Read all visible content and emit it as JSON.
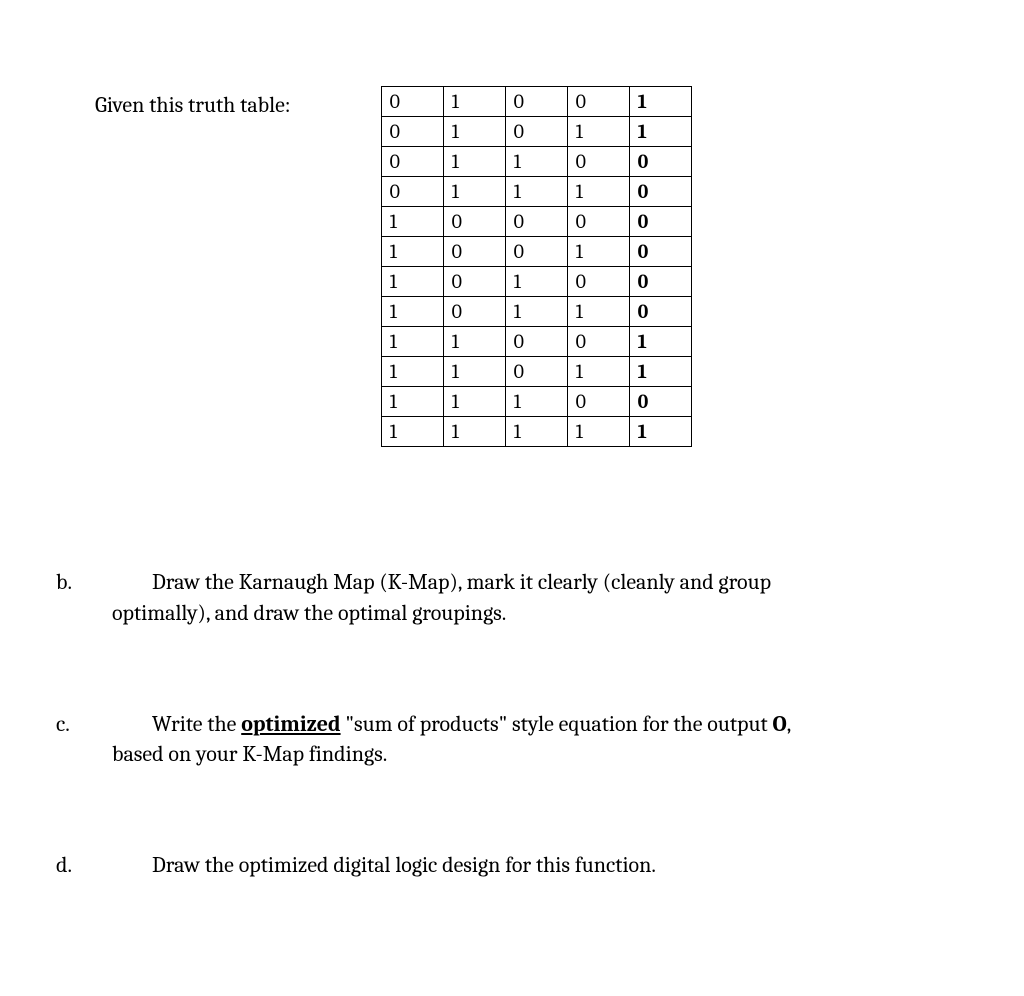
{
  "prompt": "Given this truth table:",
  "chart_data": {
    "type": "table",
    "columns": 5,
    "rows": [
      [
        0,
        1,
        0,
        0,
        1
      ],
      [
        0,
        1,
        0,
        1,
        1
      ],
      [
        0,
        1,
        1,
        0,
        0
      ],
      [
        0,
        1,
        1,
        1,
        0
      ],
      [
        1,
        0,
        0,
        0,
        0
      ],
      [
        1,
        0,
        0,
        1,
        0
      ],
      [
        1,
        0,
        1,
        0,
        0
      ],
      [
        1,
        0,
        1,
        1,
        0
      ],
      [
        1,
        1,
        0,
        0,
        1
      ],
      [
        1,
        1,
        0,
        1,
        1
      ],
      [
        1,
        1,
        1,
        0,
        0
      ],
      [
        1,
        1,
        1,
        1,
        1
      ]
    ],
    "output_column_index": 4
  },
  "questions": {
    "b": {
      "label": "b.",
      "text_lead": "Draw the Karnaugh Map (K-Map), mark it clearly (cleanly and group",
      "text_cont": "optimally), and draw the optimal groupings."
    },
    "c": {
      "label": "c.",
      "pre": "Write the ",
      "emph": "optimized",
      "mid": " \"sum of products\" style equation for the output ",
      "bold_end": "O",
      "post": ",",
      "cont": "based on your K-Map findings."
    },
    "d": {
      "label": "d.",
      "text": "Draw the optimized digital logic design for this function."
    }
  }
}
